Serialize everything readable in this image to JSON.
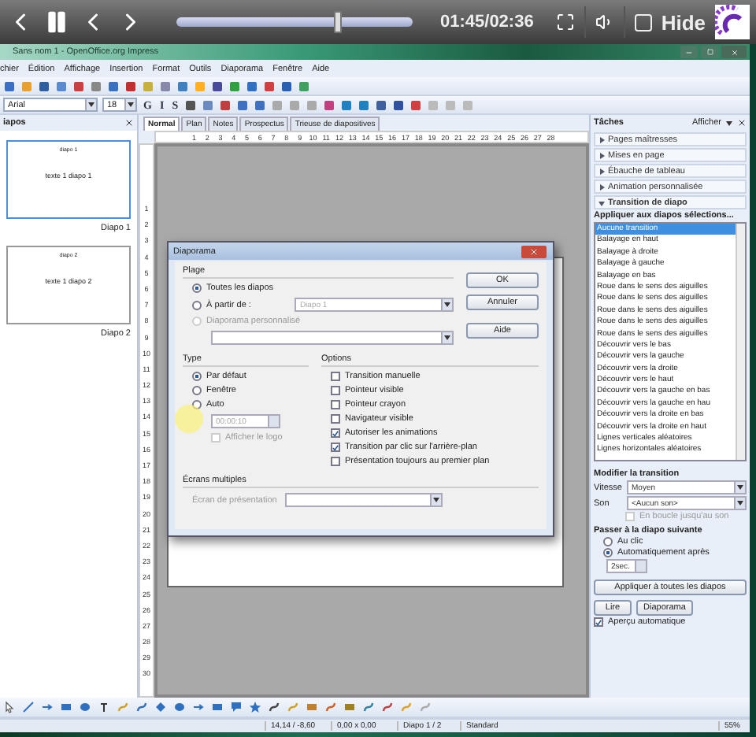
{
  "player": {
    "playing": true,
    "level": 0.68,
    "time": "01:45/02:36",
    "hide": {
      "label": "Hide",
      "checked": false
    }
  },
  "window": {
    "title": "Sans nom 1 - OpenOffice.org Impress"
  },
  "menu": [
    "chier",
    "Édition",
    "Affichage",
    "Insertion",
    "Format",
    "Outils",
    "Diaporama",
    "Fenêtre",
    "Aide"
  ],
  "format_bar": {
    "font": "Arial",
    "size": "18",
    "styles": [
      "G",
      "I",
      "S"
    ]
  },
  "slides_panel": {
    "title": "iapos",
    "slides": [
      {
        "heading": "diapo 1",
        "body": "texte 1 diapo 1",
        "label": "Diapo 1",
        "selected": true
      },
      {
        "heading": "diapo 2",
        "body": "texte 1 diapo 2",
        "label": "Diapo 2",
        "selected": false
      }
    ]
  },
  "view_tabs": [
    {
      "label": "Normal",
      "selected": true
    },
    {
      "label": "Plan",
      "selected": false
    },
    {
      "label": "Notes",
      "selected": false
    },
    {
      "label": "Prospectus",
      "selected": false
    },
    {
      "label": "Trieuse de diapositives",
      "selected": false
    }
  ],
  "ruler": [
    "1",
    "2",
    "3",
    "4",
    "5",
    "6",
    "7",
    "8",
    "9",
    "10",
    "11",
    "12",
    "13",
    "14",
    "15",
    "16",
    "17",
    "18",
    "19",
    "20",
    "21",
    "22",
    "23",
    "24",
    "25",
    "26",
    "27",
    "28"
  ],
  "vertical_ruler": [
    "1",
    "2",
    "3",
    "4",
    "5",
    "6",
    "7",
    "8",
    "9",
    "10",
    "11",
    "12",
    "13",
    "14",
    "15",
    "16",
    "17",
    "18",
    "19",
    "20",
    "21",
    "22",
    "23",
    "24",
    "25",
    "26",
    "27",
    "28",
    "29",
    "30"
  ],
  "dialog": {
    "title": "Diaporama",
    "range": {
      "title": "Plage",
      "options": [
        {
          "label": "Toutes les diapos",
          "selected": true,
          "disabled": false
        },
        {
          "label": "À partir de :",
          "selected": false,
          "disabled": false
        },
        {
          "label": "Diaporama personnalisé",
          "selected": false,
          "disabled": true
        }
      ],
      "from": "Diapo 1"
    },
    "buttons": [
      "OK",
      "Annuler",
      "Aide"
    ],
    "type": {
      "title": "Type",
      "options": [
        {
          "label": "Par défaut",
          "selected": true
        },
        {
          "label": "Fenêtre",
          "selected": false
        },
        {
          "label": "Auto",
          "selected": false
        }
      ],
      "pause": "00:00:10",
      "logo": {
        "label": "Afficher le logo",
        "checked": false
      }
    },
    "options": {
      "title": "Options",
      "items": [
        {
          "label": "Transition manuelle",
          "checked": false
        },
        {
          "label": "Pointeur visible",
          "checked": false
        },
        {
          "label": "Pointeur crayon",
          "checked": false
        },
        {
          "label": "Navigateur visible",
          "checked": false
        },
        {
          "label": "Autoriser les animations",
          "checked": true
        },
        {
          "label": "Transition par clic sur l'arrière-plan",
          "checked": true
        },
        {
          "label": "Présentation toujours au premier plan",
          "checked": false
        }
      ]
    },
    "screens": {
      "title": "Écrans multiples",
      "label": "Écran de présentation"
    }
  },
  "tasks": {
    "title": "Tâches",
    "view": "Afficher",
    "sections": [
      {
        "label": "Pages maîtresses",
        "expanded": false
      },
      {
        "label": "Mises en page",
        "expanded": false
      },
      {
        "label": "Ébauche de tableau",
        "expanded": false
      },
      {
        "label": "Animation personnalisée",
        "expanded": false
      },
      {
        "label": "Transition de diapo",
        "expanded": true
      }
    ],
    "apply_label": "Appliquer aux diapos sélections...",
    "transitions": [
      {
        "label": "Aucune transition",
        "selected": true
      },
      {
        "label": "Balayage en haut",
        "selected": false
      },
      {
        "label": "Balayage à droite",
        "selected": false
      },
      {
        "label": "Balayage à gauche",
        "selected": false
      },
      {
        "label": "Balayage en bas",
        "selected": false
      },
      {
        "label": "Roue dans le sens des aiguilles",
        "selected": false
      },
      {
        "label": "Roue dans le sens des aiguilles",
        "selected": false
      },
      {
        "label": "Roue dans le sens des aiguilles",
        "selected": false
      },
      {
        "label": "Roue dans le sens des aiguilles",
        "selected": false
      },
      {
        "label": "Roue dans le sens des aiguilles",
        "selected": false
      },
      {
        "label": "Découvrir vers le bas",
        "selected": false
      },
      {
        "label": "Découvrir vers la gauche",
        "selected": false
      },
      {
        "label": "Découvrir vers la droite",
        "selected": false
      },
      {
        "label": "Découvrir vers le haut",
        "selected": false
      },
      {
        "label": "Découvrir vers la gauche en bas",
        "selected": false
      },
      {
        "label": "Découvrir vers la gauche en hau",
        "selected": false
      },
      {
        "label": "Découvrir vers la droite en bas",
        "selected": false
      },
      {
        "label": "Découvrir vers la droite en haut",
        "selected": false
      },
      {
        "label": "Lignes verticales aléatoires",
        "selected": false
      },
      {
        "label": "Lignes horizontales aléatoires",
        "selected": false
      }
    ],
    "modify_title": "Modifier la transition",
    "speed_label": "Vitesse",
    "speed": "Moyen",
    "sound_label": "Son",
    "sound": "<Aucun son>",
    "loop": {
      "label": "En boucle jusqu'au son",
      "checked": false
    },
    "advance_title": "Passer à la diapo suivante",
    "advance": [
      {
        "label": "Au clic",
        "selected": false
      },
      {
        "label": "Automatiquement après",
        "selected": true
      }
    ],
    "delay": "2sec.",
    "apply_all": "Appliquer à toutes les diapos",
    "play": "Lire",
    "slideshow": "Diaporama",
    "preview": {
      "label": "Aperçu automatique",
      "checked": true
    }
  },
  "status_bar": [
    "14,14 / -8,60",
    "0,00 x 0,00",
    "Diapo 1 / 2",
    "Standard",
    "55%"
  ]
}
